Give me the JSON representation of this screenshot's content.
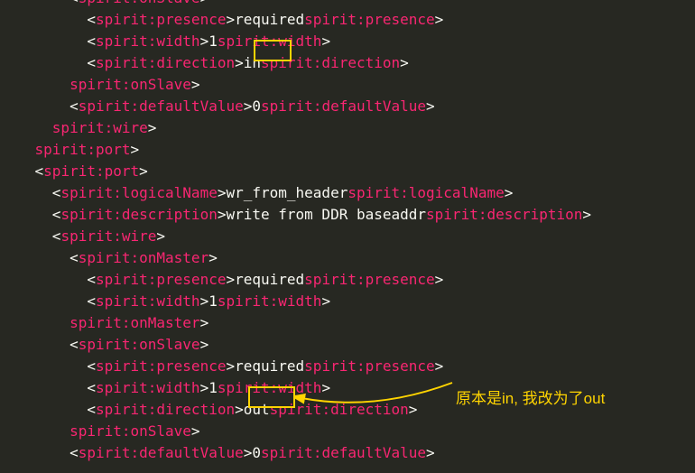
{
  "lines": [
    {
      "ind": 4,
      "open": "spirit:onSlave",
      "val": "",
      "close": ""
    },
    {
      "ind": 5,
      "open": "spirit:presence",
      "val": "required",
      "close": "spirit:presence"
    },
    {
      "ind": 5,
      "open": "spirit:width",
      "val": "1",
      "close": "spirit:width"
    },
    {
      "ind": 5,
      "open": "spirit:direction",
      "val": "in",
      "close": "spirit:direction"
    },
    {
      "ind": 4,
      "close_only": "spirit:onSlave"
    },
    {
      "ind": 4,
      "open": "spirit:defaultValue",
      "val": "0",
      "close": "spirit:defaultValue"
    },
    {
      "ind": 3,
      "close_only": "spirit:wire"
    },
    {
      "ind": 2,
      "close_only": "spirit:port"
    },
    {
      "ind": 2,
      "open": "spirit:port",
      "val": "",
      "close": ""
    },
    {
      "ind": 3,
      "open": "spirit:logicalName",
      "val": "wr_from_header",
      "close": "spirit:logicalName"
    },
    {
      "ind": 3,
      "open": "spirit:description",
      "val": "write from DDR baseaddr",
      "close": "spirit:description"
    },
    {
      "ind": 3,
      "open": "spirit:wire",
      "val": "",
      "close": ""
    },
    {
      "ind": 4,
      "open": "spirit:onMaster",
      "val": "",
      "close": ""
    },
    {
      "ind": 5,
      "open": "spirit:presence",
      "val": "required",
      "close": "spirit:presence"
    },
    {
      "ind": 5,
      "open": "spirit:width",
      "val": "1",
      "close": "spirit:width"
    },
    {
      "ind": 4,
      "close_only": "spirit:onMaster"
    },
    {
      "ind": 4,
      "open": "spirit:onSlave",
      "val": "",
      "close": ""
    },
    {
      "ind": 5,
      "open": "spirit:presence",
      "val": "required",
      "close": "spirit:presence"
    },
    {
      "ind": 5,
      "open": "spirit:width",
      "val": "1",
      "close": "spirit:width"
    },
    {
      "ind": 5,
      "open": "spirit:direction",
      "val": "out",
      "close": "spirit:direction"
    },
    {
      "ind": 4,
      "close_only": "spirit:onSlave"
    },
    {
      "ind": 4,
      "open": "spirit:defaultValue",
      "val": "0",
      "close": "spirit:defaultValue"
    }
  ],
  "indent_str": "  ",
  "brackets": {
    "lt": "<",
    "gt": ">",
    "slash": "</"
  },
  "annotation": "原本是in, 我改为了out"
}
